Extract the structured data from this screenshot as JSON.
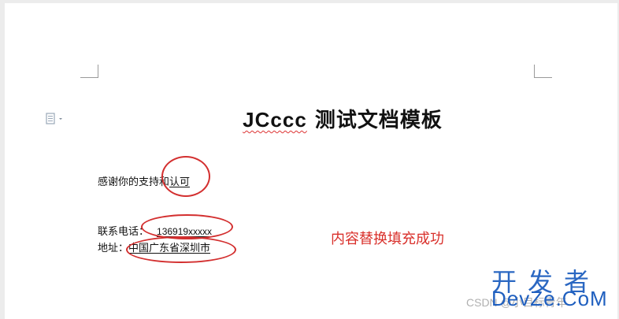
{
  "document": {
    "title_brand": "JCccc",
    "title_rest": " 测试文档模板",
    "line1_text": "感谢你的支持和",
    "line1_value": "认可",
    "line2_label": "联系电话：",
    "line2_value": "136919xxxxx",
    "line3_label": "地址：",
    "line3_value": "中国广东省深圳市"
  },
  "annotation": {
    "note": "内容替换填充成功",
    "color": "#d32f2f"
  },
  "watermark": {
    "cn": "开发者",
    "csdn": "CSDN @小目标青年",
    "en": "DevZe.CoM"
  },
  "icons": {
    "paste_options": "paste-options-icon"
  }
}
